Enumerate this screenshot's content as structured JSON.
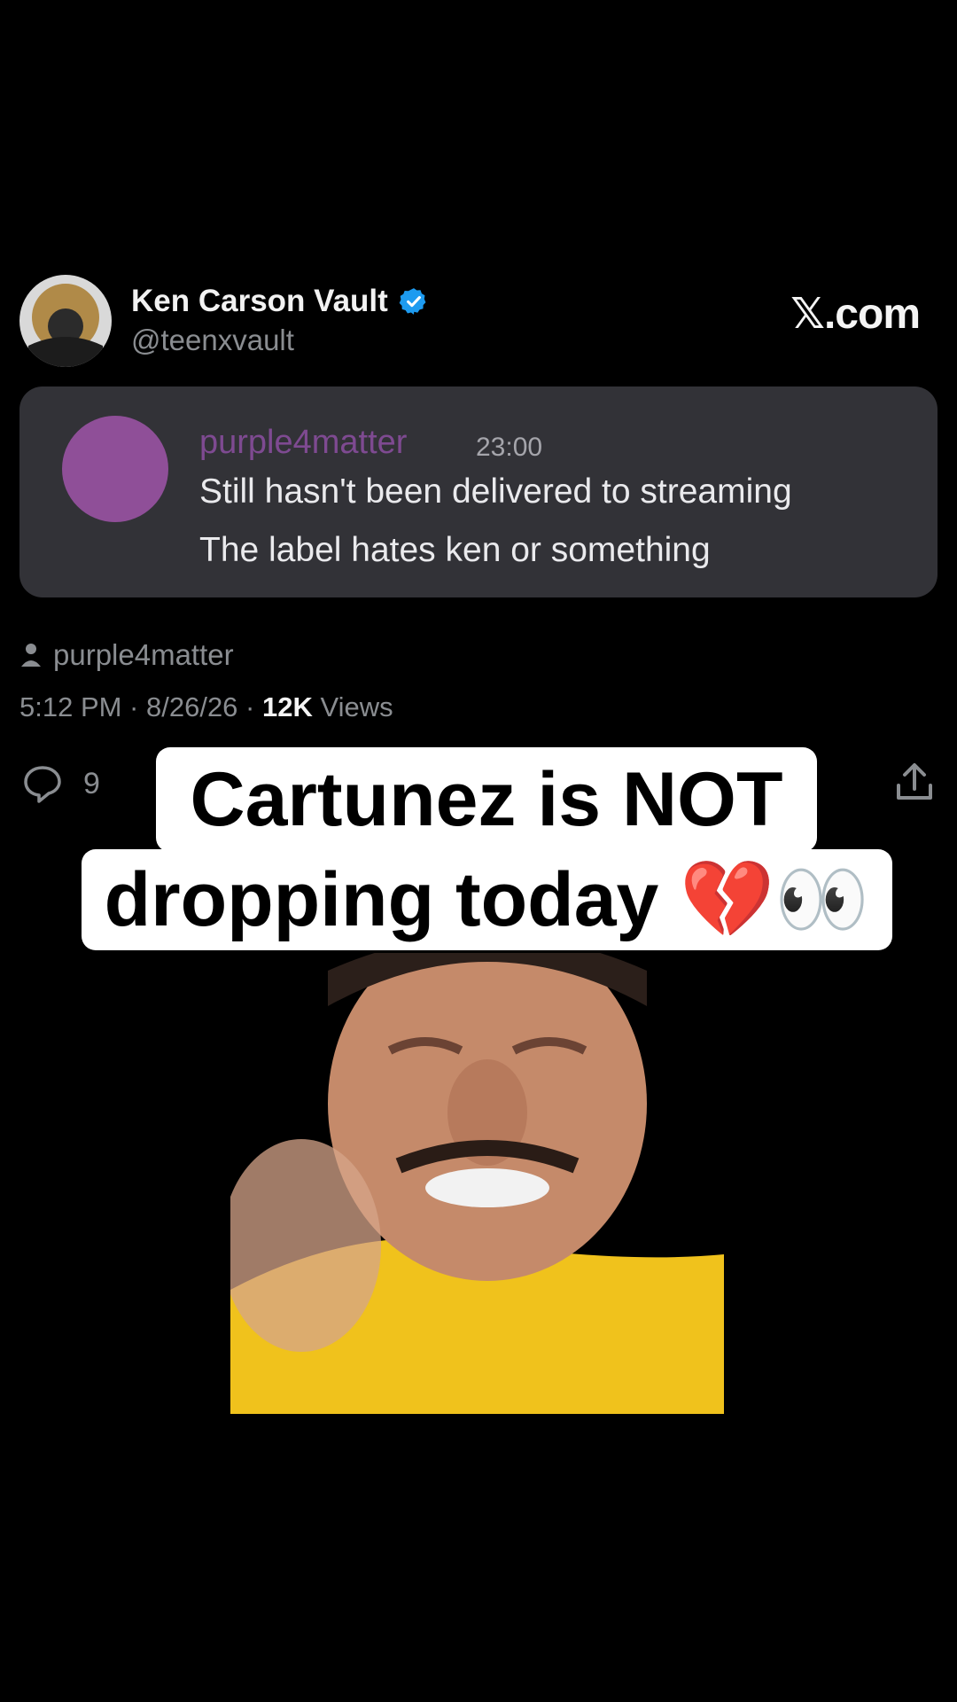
{
  "tweet": {
    "display_name": "Ken Carson Vault",
    "handle": "@teenxvault",
    "brand": "𝕏.com",
    "quote": {
      "username": "purple4matter",
      "time": "23:00",
      "line1": "Still hasn't been delivered to streaming",
      "line2": "The label hates ken or something"
    },
    "attribution": "purple4matter",
    "meta_prefix": "5:12 PM · 8/26/26 · ",
    "views_count": "12K",
    "views_label": " Views",
    "reply_count": "9"
  },
  "caption": {
    "line1": "Cartunez is NOT",
    "line2": "dropping today 💔👀"
  },
  "icons": {
    "verified": "verified-badge-icon",
    "user": "user-icon",
    "reply": "reply-icon",
    "share": "share-icon"
  },
  "colors": {
    "background": "#000000",
    "card": "#323237",
    "accent_purple": "#8f4f98",
    "verified_blue": "#1d9bf0"
  }
}
